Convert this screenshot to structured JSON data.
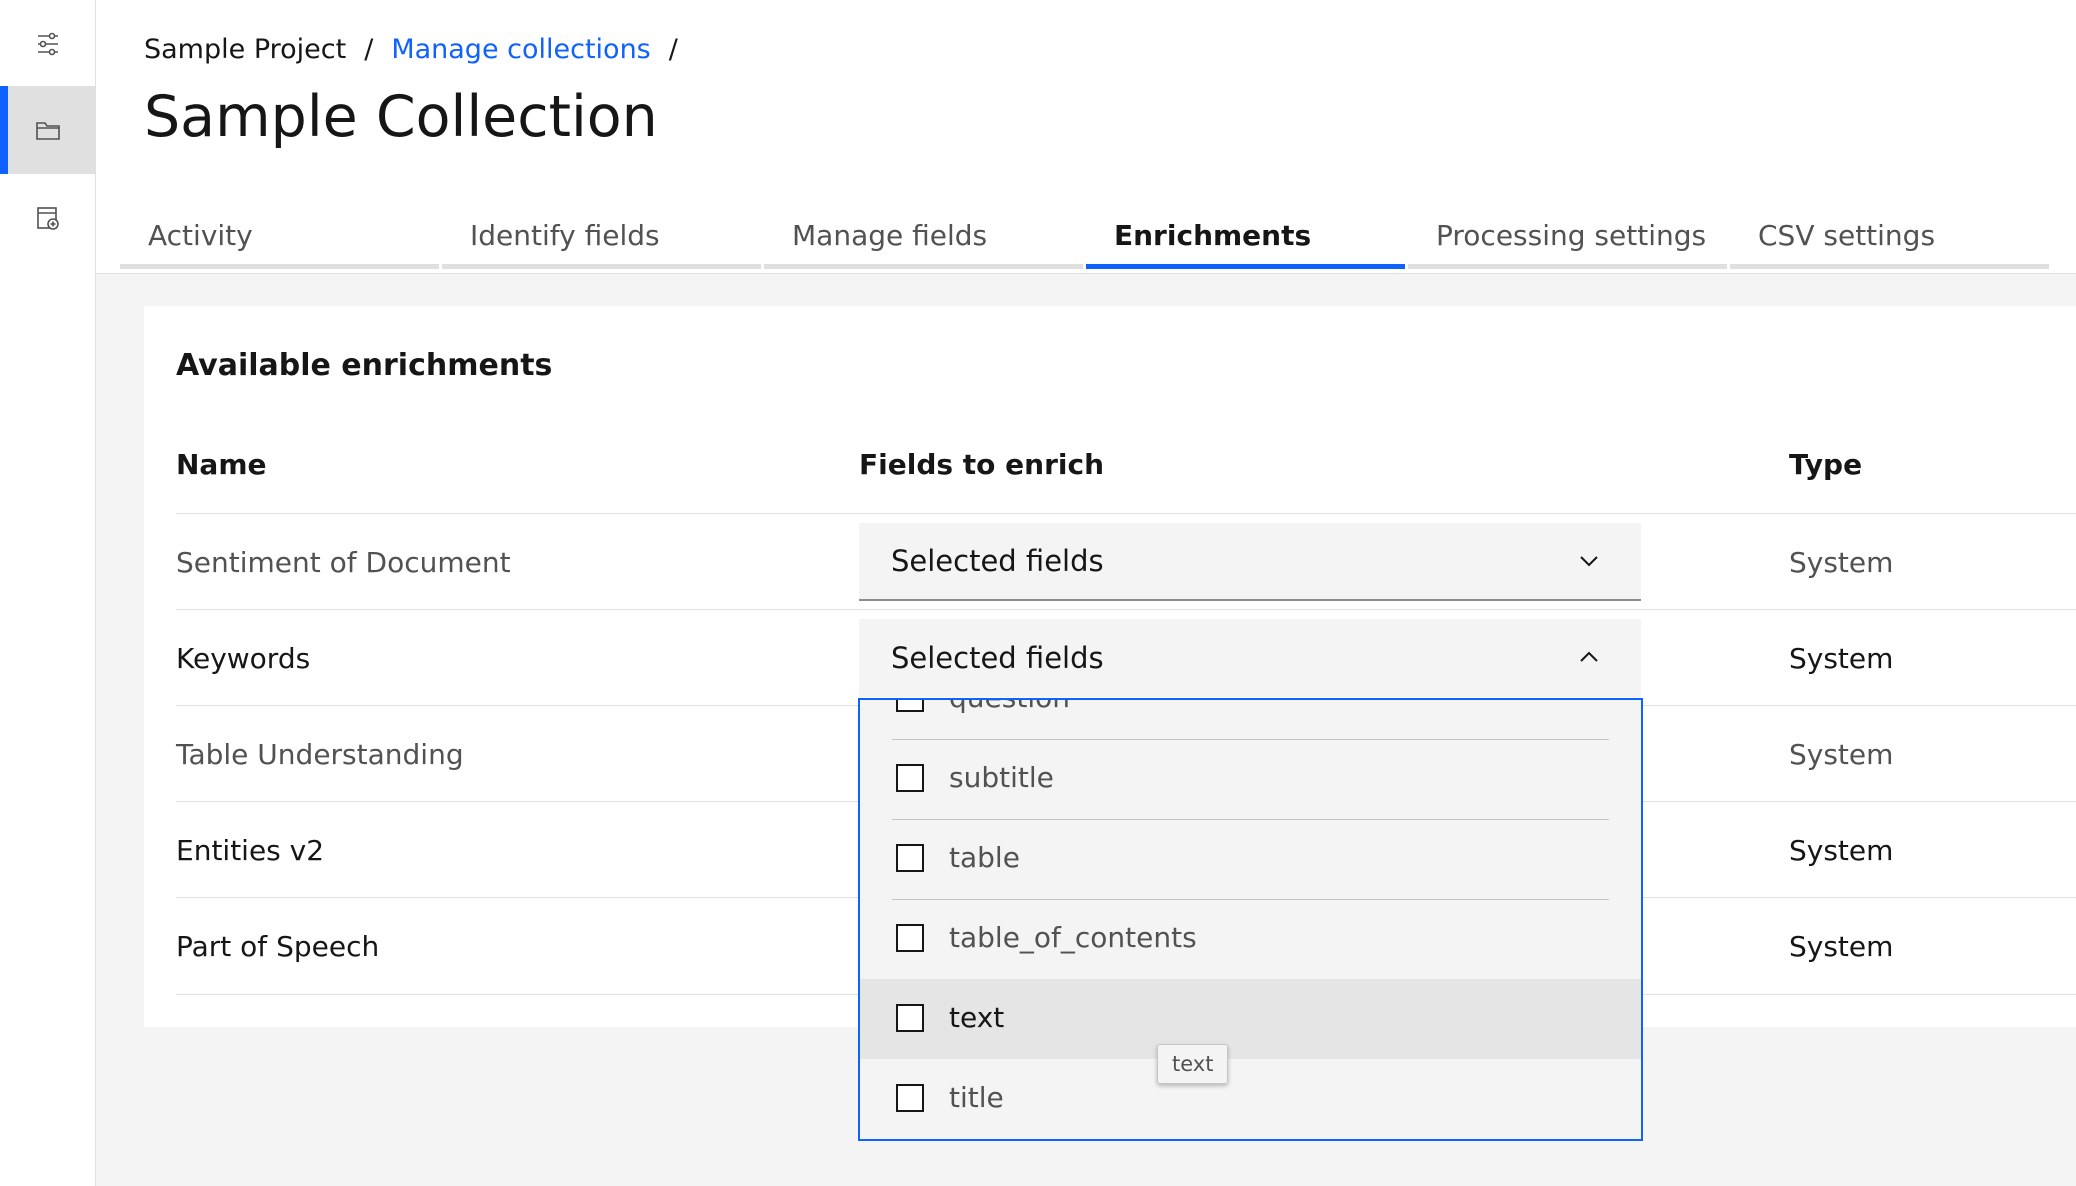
{
  "breadcrumb": {
    "project": "Sample Project",
    "collections": "Manage collections",
    "separator": "/"
  },
  "page_title": "Sample Collection",
  "tabs": [
    {
      "label": "Activity",
      "active": false
    },
    {
      "label": "Identify fields",
      "active": false
    },
    {
      "label": "Manage fields",
      "active": false
    },
    {
      "label": "Enrichments",
      "active": true
    },
    {
      "label": "Processing settings",
      "active": false
    },
    {
      "label": "CSV settings",
      "active": false
    }
  ],
  "rail": {
    "items": [
      {
        "icon": "sliders-icon",
        "active": false
      },
      {
        "icon": "folder-icon",
        "active": true
      },
      {
        "icon": "document-add-icon",
        "active": false
      }
    ]
  },
  "card": {
    "title": "Available enrichments",
    "columns": {
      "name": "Name",
      "fields": "Fields to enrich",
      "type": "Type"
    },
    "rows": [
      {
        "name": "Sentiment of Document",
        "fields": "Selected fields",
        "type": "System"
      },
      {
        "name": "Keywords",
        "fields": "Selected fields",
        "type": "System"
      },
      {
        "name": "Table Understanding",
        "type": "System"
      },
      {
        "name": "Entities v2",
        "type": "System"
      },
      {
        "name": "Part of Speech",
        "type": "System"
      }
    ]
  },
  "dropdown": {
    "options": [
      "question",
      "subtitle",
      "table",
      "table_of_contents",
      "text",
      "title"
    ],
    "hovered": "text"
  },
  "tooltip": "text",
  "colors": {
    "accent": "#0f62fe",
    "text": "#161616",
    "muted": "#525252"
  }
}
